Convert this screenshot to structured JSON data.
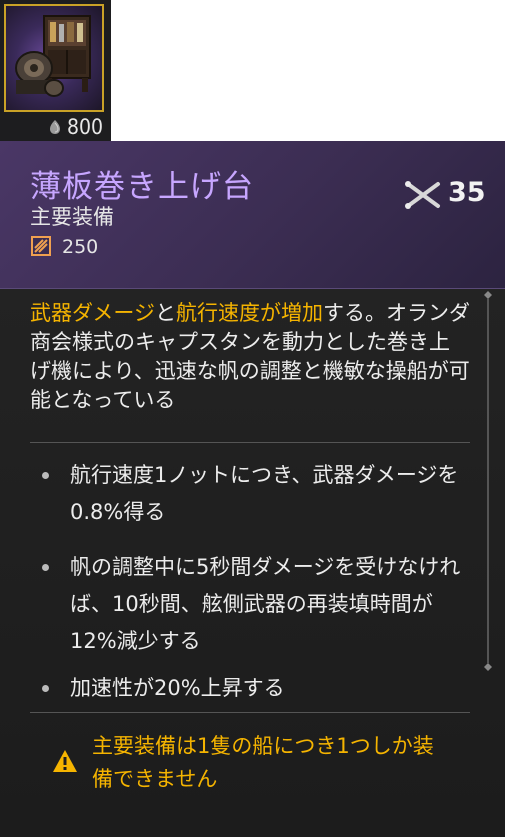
{
  "item": {
    "price": "800",
    "price_icon": "coin-icon"
  },
  "tooltip": {
    "title": "薄板巻き上げ台",
    "subtitle": "主要装備",
    "stat_icon": "sail-stat-icon",
    "stat_value": "250",
    "rating_icon": "crossed-cannons-icon",
    "rating_value": "35",
    "description": {
      "hl1": "武器ダメージ",
      "t1": "と",
      "hl2": "航行速度が増加",
      "t2": "する。オランダ商会様式のキャプスタンを動力とした巻き上げ機により、迅速な帆の調整と機敏な操船が可能となっている"
    },
    "bullets": [
      "航行速度1ノットにつき、武器ダメージを0.8%得る",
      "帆の調整中に5秒間ダメージを受けなければ、10秒間、舷側武器の再装填時間が12%減少する",
      "加速性が20%上昇する"
    ],
    "warning": "主要装備は1隻の船につき1つしか装備できません",
    "warning_icon": "warning-triangle-icon"
  },
  "colors": {
    "title": "#c7a6ff",
    "highlight": "#f5b400",
    "header_bg": "#3f2f58",
    "frame": "#c9a227"
  }
}
